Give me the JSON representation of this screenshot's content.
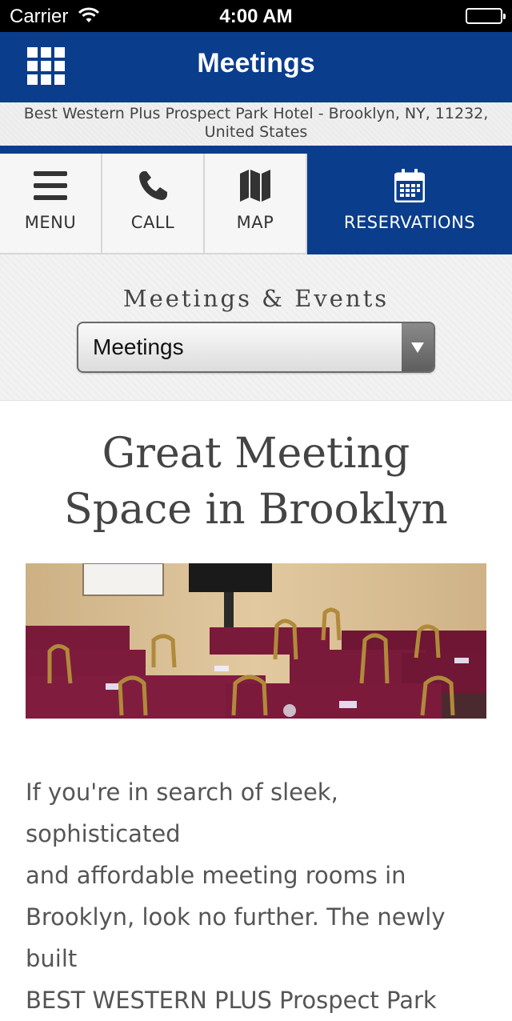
{
  "status_bar": {
    "carrier": "Carrier",
    "time": "4:00 AM"
  },
  "header": {
    "title": "Meetings",
    "menu_icon": "grid-icon"
  },
  "address": {
    "line1": "Best Western Plus Prospect Park Hotel - Brooklyn, NY, 11232,",
    "line2": "United States"
  },
  "nav": {
    "menu_label": "MENU",
    "call_label": "CALL",
    "map_label": "MAP",
    "reservations_label": "RESERVATIONS"
  },
  "events": {
    "heading": "Meetings & Events",
    "selected": "Meetings"
  },
  "content": {
    "title_line1": "Great Meeting",
    "title_line2": "Space in Brooklyn",
    "paragraph_lines": [
      "If you're in search of sleek, sophisticated",
      "and affordable meeting rooms in",
      "Brooklyn, look no further. The newly built",
      "BEST WESTERN PLUS Prospect Park"
    ]
  },
  "colors": {
    "brand_blue": "#0a3d8c",
    "tablecloth": "#7a1a3a"
  }
}
